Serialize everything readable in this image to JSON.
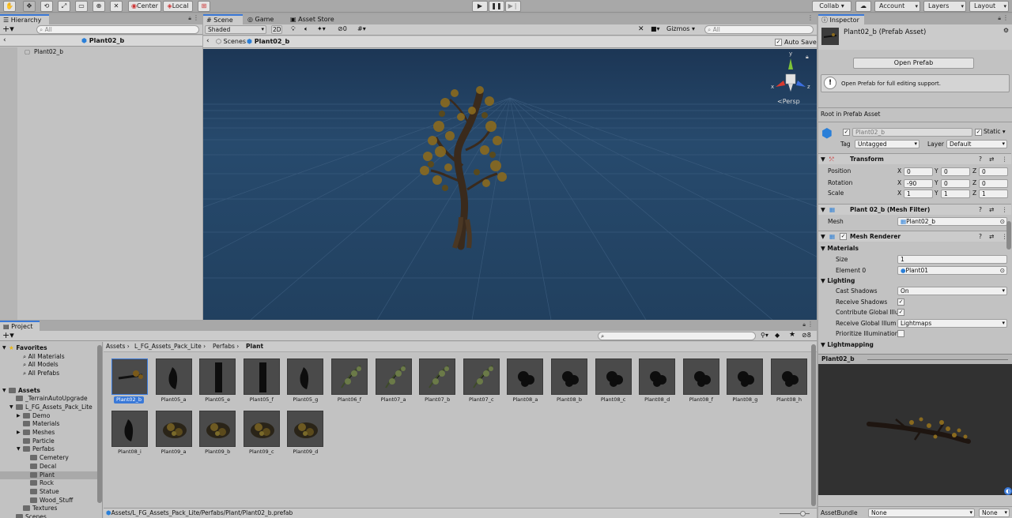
{
  "toolbar": {
    "center_label": "Center",
    "local_label": "Local",
    "collab_label": "Collab ▾",
    "account_label": "Account",
    "layers_label": "Layers",
    "layout_label": "Layout"
  },
  "hierarchy": {
    "tab": "Hierarchy",
    "search_placeholder": "All",
    "header": "Plant02_b",
    "items": [
      "Plant02_b"
    ]
  },
  "scene": {
    "tabs": [
      "Scene",
      "Game",
      "Asset Store"
    ],
    "shading": "Shaded",
    "mode_2d": "2D",
    "hidden_count": "0",
    "gizmos": "Gizmos",
    "search_placeholder": "All",
    "breadcrumb_root": "Scenes",
    "breadcrumb_item": "Plant02_b",
    "auto_save": "Auto Save",
    "persp": "Persp",
    "axis_y": "y",
    "axis_x": "x",
    "axis_z": "z",
    "colors": {
      "sky": "#21405f",
      "grid": "#3d5e80"
    }
  },
  "project": {
    "tab": "Project",
    "breadcrumb": [
      "Assets",
      "L_FG_Assets_Pack_Lite",
      "Perfabs",
      "Plant"
    ],
    "hidden_count": "8",
    "path": "Assets/L_FG_Assets_Pack_Lite/Perfabs/Plant/Plant02_b.prefab",
    "tree": [
      {
        "label": "Favorites",
        "indent": 0,
        "arrow": "▼",
        "star": true
      },
      {
        "label": "All Materials",
        "indent": 2
      },
      {
        "label": "All Models",
        "indent": 2
      },
      {
        "label": "All Prefabs",
        "indent": 2
      },
      {
        "label": "",
        "indent": 0
      },
      {
        "label": "Assets",
        "indent": 0,
        "arrow": "▼",
        "folder": true
      },
      {
        "label": "_TerrainAutoUpgrade",
        "indent": 1,
        "folder": true
      },
      {
        "label": "L_FG_Assets_Pack_Lite",
        "indent": 1,
        "arrow": "▼",
        "folder": true
      },
      {
        "label": "Demo",
        "indent": 2,
        "arrow": "▶",
        "folder": true
      },
      {
        "label": "Materials",
        "indent": 2,
        "folder": true
      },
      {
        "label": "Meshes",
        "indent": 2,
        "arrow": "▶",
        "folder": true
      },
      {
        "label": "Particle",
        "indent": 2,
        "folder": true
      },
      {
        "label": "Perfabs",
        "indent": 2,
        "arrow": "▼",
        "folder": true
      },
      {
        "label": "Cemetery",
        "indent": 3,
        "folder": true
      },
      {
        "label": "Decal",
        "indent": 3,
        "folder": true
      },
      {
        "label": "Plant",
        "indent": 3,
        "folder": true,
        "selected": true
      },
      {
        "label": "Rock",
        "indent": 3,
        "folder": true
      },
      {
        "label": "Statue",
        "indent": 3,
        "folder": true
      },
      {
        "label": "Wood_Stuff",
        "indent": 3,
        "folder": true
      },
      {
        "label": "Textures",
        "indent": 2,
        "folder": true
      },
      {
        "label": "Scenes",
        "indent": 1,
        "folder": true
      }
    ],
    "assets": [
      {
        "name": "Plant02_b",
        "kind": "tree",
        "selected": true
      },
      {
        "name": "Plant05_a",
        "kind": "dark"
      },
      {
        "name": "Plant05_e",
        "kind": "trunk"
      },
      {
        "name": "Plant05_f",
        "kind": "trunk"
      },
      {
        "name": "Plant05_g",
        "kind": "dark"
      },
      {
        "name": "Plant06_f",
        "kind": "green"
      },
      {
        "name": "Plant07_a",
        "kind": "green"
      },
      {
        "name": "Plant07_b",
        "kind": "green"
      },
      {
        "name": "Plant07_c",
        "kind": "green"
      },
      {
        "name": "Plant08_a",
        "kind": "bush"
      },
      {
        "name": "Plant08_b",
        "kind": "bush"
      },
      {
        "name": "Plant08_c",
        "kind": "bush"
      },
      {
        "name": "Plant08_d",
        "kind": "bush"
      },
      {
        "name": "Plant08_f",
        "kind": "bush"
      },
      {
        "name": "Plant08_g",
        "kind": "bush"
      },
      {
        "name": "Plant08_h",
        "kind": "bush"
      },
      {
        "name": "Plant08_i",
        "kind": "dark"
      },
      {
        "name": "Plant09_a",
        "kind": "shrub"
      },
      {
        "name": "Plant09_b",
        "kind": "shrub"
      },
      {
        "name": "Plant09_c",
        "kind": "shrub"
      },
      {
        "name": "Plant09_d",
        "kind": "shrub"
      }
    ]
  },
  "inspector": {
    "tab": "Inspector",
    "title": "Plant02_b (Prefab Asset)",
    "open_prefab": "Open Prefab",
    "help": "Open Prefab for full editing support.",
    "root_label": "Root in Prefab Asset",
    "name_value": "Plant02_b",
    "static_label": "Static",
    "tag_label": "Tag",
    "tag_value": "Untagged",
    "layer_label": "Layer",
    "layer_value": "Default",
    "transform": {
      "title": "Transform",
      "rows": [
        {
          "label": "Position",
          "x": "0",
          "y": "0",
          "z": "0"
        },
        {
          "label": "Rotation",
          "x": "-90",
          "y": "0",
          "z": "0"
        },
        {
          "label": "Scale",
          "x": "1",
          "y": "1",
          "z": "1"
        }
      ]
    },
    "mesh_filter": {
      "title": "Plant 02_b (Mesh Filter)",
      "mesh_label": "Mesh",
      "mesh_value": "Plant02_b"
    },
    "mesh_renderer": {
      "title": "Mesh Renderer",
      "materials": "Materials",
      "size_label": "Size",
      "size_value": "1",
      "element_label": "Element 0",
      "element_value": "Plant01",
      "lighting": "Lighting",
      "cast_label": "Cast Shadows",
      "cast_value": "On",
      "receive_label": "Receive Shadows",
      "contribute_label": "Contribute Global Illu",
      "receive_gi_label": "Receive Global Illum",
      "receive_gi_value": "Lightmaps",
      "prioritize_label": "Prioritize Illumination",
      "lightmapping": "Lightmapping"
    },
    "preview_title": "Plant02_b",
    "assetbundle_label": "AssetBundle",
    "assetbundle_value": "None",
    "assetbundle_variant": "None"
  }
}
